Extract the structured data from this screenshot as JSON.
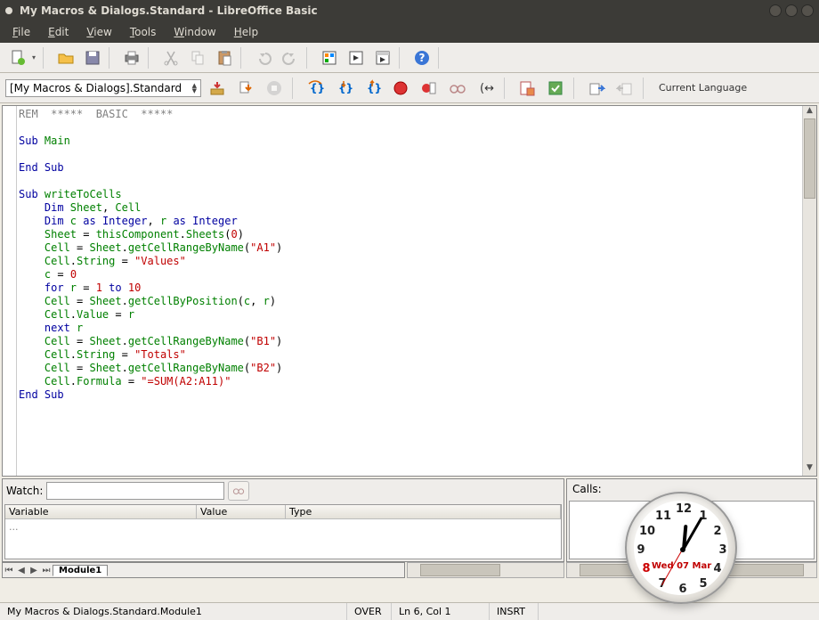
{
  "window": {
    "title": "My Macros & Dialogs.Standard - LibreOffice Basic"
  },
  "menubar": [
    "File",
    "Edit",
    "View",
    "Tools",
    "Window",
    "Help"
  ],
  "library_selector": "[My Macros & Dialogs].Standard",
  "language_label": "Current Language",
  "code": {
    "l1a": "REM  *****  BASIC  *****",
    "l3a": "Sub",
    "l3b": " Main",
    "l5a": "End Sub",
    "l7a": "Sub",
    "l7b": " writeToCells",
    "l8a": "    Dim",
    "l8b": " Sheet",
    "l8c": ",",
    "l8d": " Cell",
    "l9a": "    Dim",
    "l9b": " c ",
    "l9c": "as Integer",
    "l9d": ",",
    "l9e": " r ",
    "l9f": "as Integer",
    "l10a": "    Sheet ",
    "l10b": "=",
    "l10c": " thisComponent",
    "l10d": ".",
    "l10e": "Sheets",
    "l10f": "(",
    "l10g": "0",
    "l10h": ")",
    "l11a": "    Cell ",
    "l11b": "=",
    "l11c": " Sheet",
    "l11d": ".",
    "l11e": "getCellRangeByName",
    "l11f": "(",
    "l11g": "\"A1\"",
    "l11h": ")",
    "l12a": "    Cell",
    "l12b": ".",
    "l12c": "String ",
    "l12d": "= ",
    "l12e": "\"Values\"",
    "l13a": "    c ",
    "l13b": "= ",
    "l13c": "0",
    "l14a": "    for",
    "l14b": " r ",
    "l14c": "= ",
    "l14d": "1",
    "l14e": " to ",
    "l14f": "10",
    "l15a": "    Cell ",
    "l15b": "=",
    "l15c": " Sheet",
    "l15d": ".",
    "l15e": "getCellByPosition",
    "l15f": "(",
    "l15g": "c",
    "l15h": ",",
    "l15i": " r",
    "l15j": ")",
    "l16a": "    Cell",
    "l16b": ".",
    "l16c": "Value ",
    "l16d": "=",
    "l16e": " r",
    "l17a": "    next",
    "l17b": " r",
    "l18a": "    Cell ",
    "l18b": "=",
    "l18c": " Sheet",
    "l18d": ".",
    "l18e": "getCellRangeByName",
    "l18f": "(",
    "l18g": "\"B1\"",
    "l18h": ")",
    "l19a": "    Cell",
    "l19b": ".",
    "l19c": "String ",
    "l19d": "= ",
    "l19e": "\"Totals\"",
    "l20a": "    Cell ",
    "l20b": "=",
    "l20c": " Sheet",
    "l20d": ".",
    "l20e": "getCellRangeByName",
    "l20f": "(",
    "l20g": "\"B2\"",
    "l20h": ")",
    "l21a": "    Cell",
    "l21b": ".",
    "l21c": "Formula ",
    "l21d": "= ",
    "l21e": "\"=SUM(A2:A11)\"",
    "l22a": "End Sub"
  },
  "watch": {
    "label": "Watch:",
    "col_variable": "Variable",
    "col_value": "Value",
    "col_type": "Type",
    "empty": "..."
  },
  "calls": {
    "label": "Calls:"
  },
  "tab": {
    "module1": "Module1"
  },
  "status": {
    "path": "My Macros & Dialogs.Standard.Module1",
    "over": "OVER",
    "pos": "Ln 6, Col 1",
    "ins": "INSRT"
  },
  "clock": {
    "n12": "12",
    "n1": "1",
    "n2": "2",
    "n3": "3",
    "n4": "4",
    "n5": "5",
    "n6": "6",
    "n7": "7",
    "n8": "8",
    "n9": "9",
    "n10": "10",
    "n11": "11",
    "date": "Wed 07 Mar"
  }
}
